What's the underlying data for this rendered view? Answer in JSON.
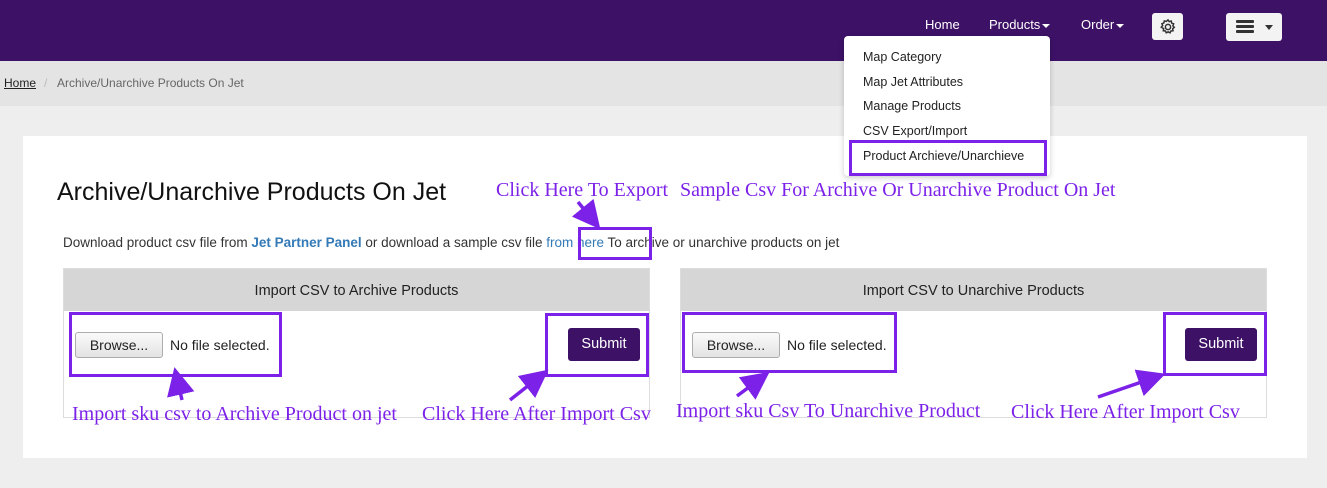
{
  "nav": {
    "home": "Home",
    "products": "Products",
    "order": "Order"
  },
  "icons": [
    "gear-icon",
    "server-icon",
    "caret-down-icon"
  ],
  "colors": {
    "navbar": "#3d1166",
    "accent": "#7c21e8",
    "link": "#337ab7"
  },
  "breadcrumb": {
    "home": "Home",
    "separator": "/",
    "current": "Archive/Unarchive Products On Jet"
  },
  "products_menu": {
    "items": [
      "Map Category",
      "Map Jet Attributes",
      "Manage Products",
      "CSV Export/Import",
      "Product Archieve/Unarchieve"
    ]
  },
  "page": {
    "title": "Archive/Unarchive Products On Jet",
    "desc_prefix": "Download product csv file from ",
    "desc_link": "Jet Partner Panel",
    "desc_middle": " or download a sample csv file ",
    "desc_here": "from here",
    "desc_suffix": " To archive or unarchive products on jet"
  },
  "archive_card": {
    "title": "Import CSV to Archive Products",
    "browse": "Browse...",
    "no_file": "No file selected.",
    "submit": "Submit"
  },
  "unarchive_card": {
    "title": "Import CSV to Unarchive Products",
    "browse": "Browse...",
    "no_file": "No file selected.",
    "submit": "Submit"
  },
  "annotations": {
    "export_left": "Click Here To Export",
    "export_right": "Sample Csv For Archive Or Unarchive Product On Jet",
    "import_archive": "Import sku csv to Archive Product on jet",
    "after_import_1": "Click Here After Import Csv",
    "import_unarchive": "Import sku Csv To Unarchive Product",
    "after_import_2": "Click Here After Import Csv"
  }
}
